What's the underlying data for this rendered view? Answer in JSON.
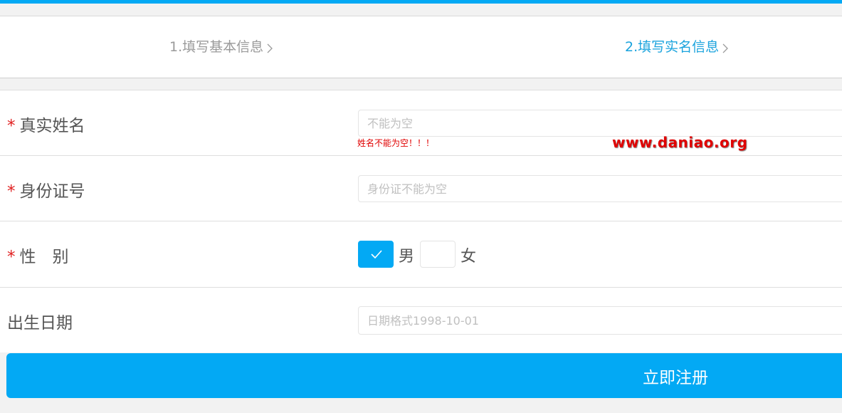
{
  "steps": [
    {
      "label": "1.填写基本信息",
      "active": false
    },
    {
      "label": "2.填写实名信息",
      "active": true
    }
  ],
  "form": {
    "real_name": {
      "label": "真实姓名",
      "required_mark": "*",
      "value": "",
      "placeholder": "不能为空",
      "error": "姓名不能为空！！！"
    },
    "id_number": {
      "label": "身份证号",
      "required_mark": "*",
      "value": "",
      "placeholder": "身份证不能为空"
    },
    "gender": {
      "label": "性　别",
      "required_mark": "*",
      "options": [
        {
          "label": "男",
          "checked": true
        },
        {
          "label": "女",
          "checked": false
        }
      ]
    },
    "birth_date": {
      "label": "出生日期",
      "value": "",
      "placeholder": "日期格式1998-10-01"
    }
  },
  "watermark": "www.daniao.org",
  "submit_label": "立即注册",
  "colors": {
    "accent": "#03a9f4",
    "active_step": "#1aa3dd",
    "error": "#e00000"
  }
}
